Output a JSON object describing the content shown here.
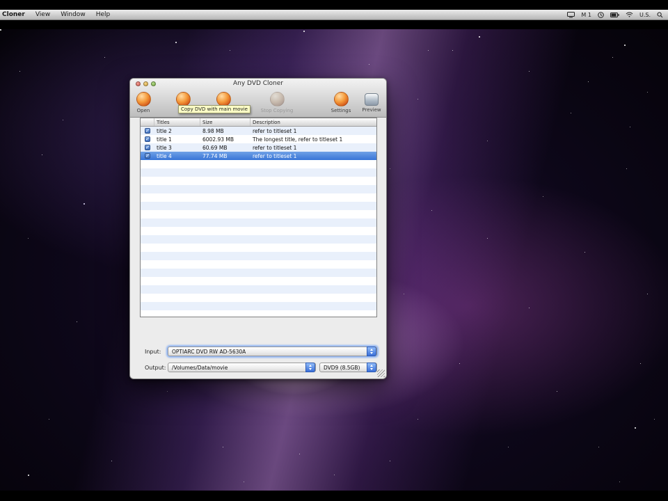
{
  "menu_bar": {
    "app_menu": "Cloner",
    "menus": [
      "View",
      "Window",
      "Help"
    ],
    "status": {
      "display_label": "M 1",
      "input_source": "U.S."
    }
  },
  "window": {
    "title": "Any DVD Cloner",
    "toolbar": {
      "tooltip": "Copy DVD with main movie",
      "items": [
        {
          "label": "Open"
        },
        {
          "label": ""
        },
        {
          "label": ""
        },
        {
          "label": "Stop Copying"
        },
        {
          "label": "Settings"
        },
        {
          "label": "Preview"
        }
      ]
    },
    "table": {
      "headers": [
        "Titles",
        "Size",
        "Description"
      ],
      "rows": [
        {
          "checked": true,
          "title": "title 2",
          "size": "8.98 MB",
          "description": "refer to titleset 1",
          "selected": false
        },
        {
          "checked": true,
          "title": "title 1",
          "size": "6002.93 MB",
          "description": "The longest title, refer to titleset 1",
          "selected": false
        },
        {
          "checked": true,
          "title": "title 3",
          "size": "60.69 MB",
          "description": "refer to titleset 1",
          "selected": false
        },
        {
          "checked": true,
          "title": "title 4",
          "size": "77.74 MB",
          "description": "refer to titleset 1",
          "selected": true
        }
      ]
    },
    "io": {
      "input_label": "Input:",
      "input_value": "OPTIARC DVD RW AD-5630A",
      "output_label": "Output:",
      "output_path": "/Volumes/Data/movie",
      "output_format": "DVD9 (8.5GB)"
    },
    "colors": {
      "selection": "#3875d7",
      "tooltip_bg": "#feffc6",
      "toolbar_icon_orange": "#e06a1e"
    }
  }
}
